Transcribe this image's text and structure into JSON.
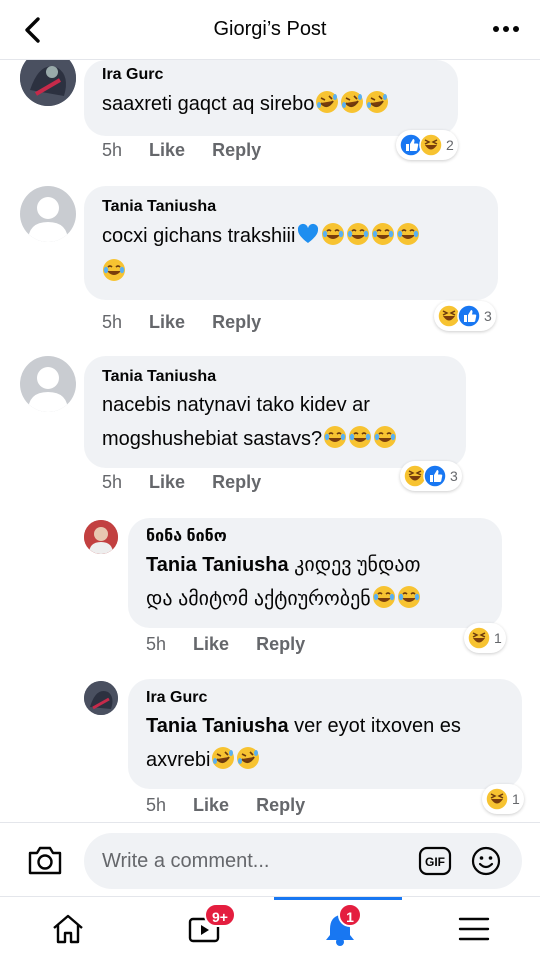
{
  "header": {
    "title": "Giorgi’s Post"
  },
  "actions": {
    "like": "Like",
    "reply": "Reply"
  },
  "comments": [
    {
      "author": "Ira Gurc",
      "text": "saaxreti gaqct aq sirebo",
      "time": "5h",
      "reaction_count": "2"
    },
    {
      "author": "Tania Taniusha",
      "text": "cocxi gichans trakshiii",
      "time": "5h",
      "reaction_count": "3"
    },
    {
      "author": "Tania Taniusha",
      "text_line1": "nacebis natynavi tako kidev ar",
      "text_line2": "mogshushebiat sastavs?",
      "time": "5h",
      "reaction_count": "3"
    },
    {
      "author": "ნინა ნინო",
      "mention": "Tania Taniusha",
      "text_line1": " კიდევ უნდათ",
      "text_line2": "და ამიტომ აქტიურობენ",
      "time": "5h",
      "reaction_count": "1"
    },
    {
      "author": "Ira Gurc",
      "mention": "Tania Taniusha",
      "text_line1": " ver eyot itxoven es",
      "text_line2": "axvrebi",
      "time": "5h",
      "reaction_count": "1"
    }
  ],
  "composer": {
    "placeholder": "Write a comment...",
    "gif_label": "GIF"
  },
  "tabbar": {
    "video_badge": "9+",
    "notif_badge": "1"
  },
  "colors": {
    "accent": "#1877f2",
    "bubble": "#f0f2f5",
    "badge": "#e41e3f",
    "meta": "#65676b"
  }
}
